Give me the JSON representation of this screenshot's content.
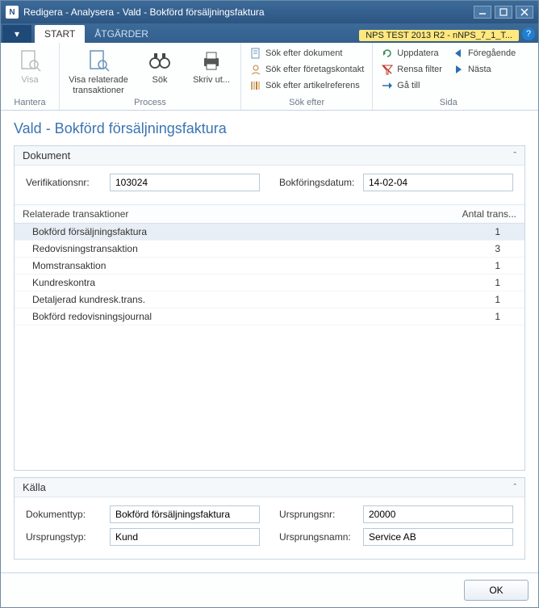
{
  "window": {
    "title": "Redigera - Analysera - Vald - Bokförd försäljningsfaktura",
    "app_icon_text": "N"
  },
  "tabs": {
    "file_glyph": "▾",
    "start": "START",
    "actions": "ÅTGÄRDER"
  },
  "env_badge": "NPS TEST 2013 R2 - nNPS_7_1_T...",
  "ribbon": {
    "manage": {
      "label": "Hantera",
      "show": "Visa"
    },
    "process": {
      "label": "Process",
      "related": "Visa relaterade transaktioner",
      "find": "Sök",
      "print": "Skriv ut..."
    },
    "search": {
      "label": "Sök efter",
      "doc": "Sök efter dokument",
      "contact": "Sök efter företagskontakt",
      "itemref": "Sök efter artikelreferens"
    },
    "page": {
      "label": "Sida",
      "refresh": "Uppdatera",
      "clear": "Rensa filter",
      "goto": "Gå till",
      "prev": "Föregående",
      "next": "Nästa"
    }
  },
  "page_title": "Vald - Bokförd försäljningsfaktura",
  "doc_section": {
    "title": "Dokument",
    "verif_label": "Verifikationsnr:",
    "verif_value": "103024",
    "date_label": "Bokföringsdatum:",
    "date_value": "14-02-04",
    "col_related": "Relaterade transaktioner",
    "col_count": "Antal trans...",
    "rows": [
      {
        "name": "Bokförd försäljningsfaktura",
        "count": "1"
      },
      {
        "name": "Redovisningstransaktion",
        "count": "3"
      },
      {
        "name": "Momstransaktion",
        "count": "1"
      },
      {
        "name": "Kundreskontra",
        "count": "1"
      },
      {
        "name": "Detaljerad kundresk.trans.",
        "count": "1"
      },
      {
        "name": "Bokförd redovisningsjournal",
        "count": "1"
      }
    ]
  },
  "src_section": {
    "title": "Källa",
    "doc_type_label": "Dokumenttyp:",
    "doc_type_value": "Bokförd försäljningsfaktura",
    "origin_type_label": "Ursprungstyp:",
    "origin_type_value": "Kund",
    "origin_no_label": "Ursprungsnr:",
    "origin_no_value": "20000",
    "origin_name_label": "Ursprungsnamn:",
    "origin_name_value": "Service AB"
  },
  "footer": {
    "ok": "OK"
  }
}
